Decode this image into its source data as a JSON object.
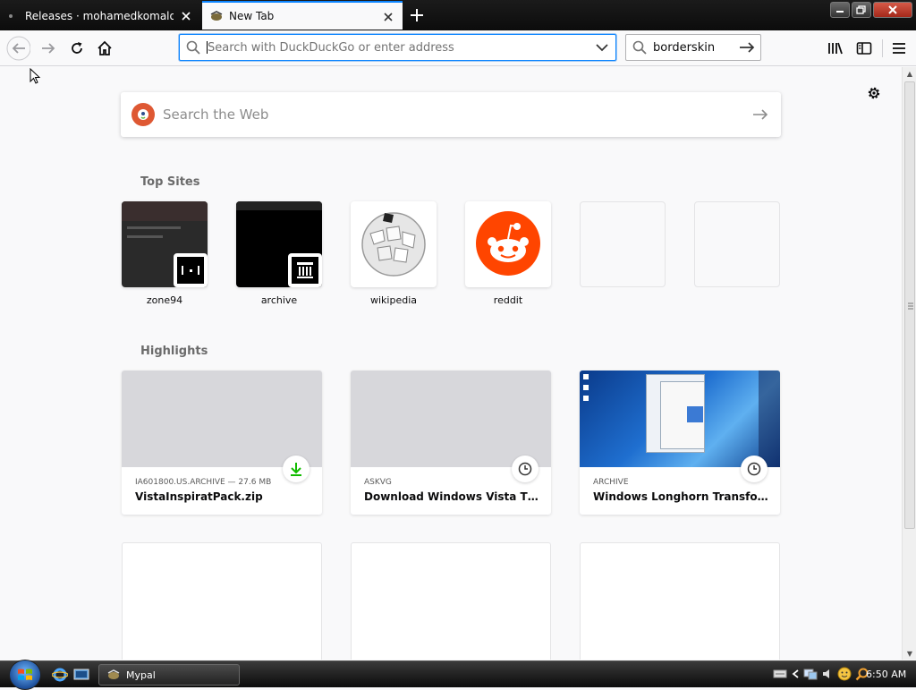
{
  "browser": {
    "tabs": [
      {
        "title": "Releases · mohamedkomalo/Bordersk",
        "active": false
      },
      {
        "title": "New Tab",
        "active": true
      }
    ],
    "urlbar": {
      "placeholder": "Search with DuckDuckGo or enter address"
    },
    "searchbar": {
      "value": "borderskin"
    }
  },
  "newtab": {
    "websearch": {
      "placeholder": "Search the Web"
    },
    "top_sites_title": "Top Sites",
    "top_sites": [
      {
        "label": "zone94"
      },
      {
        "label": "archive"
      },
      {
        "label": "wikipedia"
      },
      {
        "label": "reddit"
      },
      {
        "label": ""
      },
      {
        "label": ""
      }
    ],
    "highlights_title": "Highlights",
    "highlights": [
      {
        "source": "IA601800.US.ARCHIVE — 27.6 MB",
        "title": "VistaInspiratPack.zip",
        "badge": "download-icon"
      },
      {
        "source": "ASKVG",
        "title": "Download Windows Vista Them...",
        "badge": "history-icon"
      },
      {
        "source": "ARCHIVE",
        "title": "Windows Longhorn Transformat...",
        "badge": "history-icon"
      }
    ]
  },
  "taskbar": {
    "task_label": "Mypal",
    "clock": "6:50 AM"
  },
  "colors": {
    "accent": "#0a84ff",
    "reddit": "#ff4500",
    "ddg": "#de5833",
    "download_green": "#12bc00"
  }
}
